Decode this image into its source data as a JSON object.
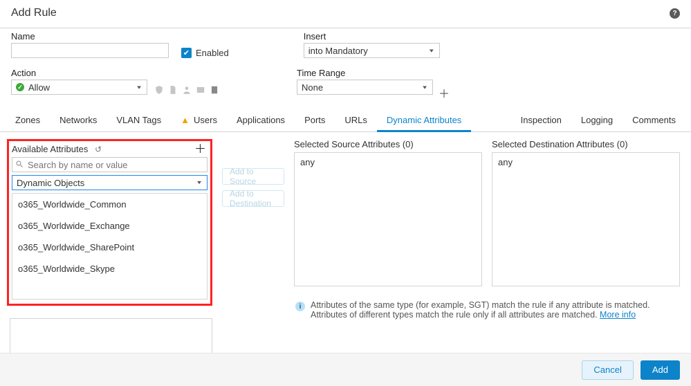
{
  "title": "Add Rule",
  "fields": {
    "name_label": "Name",
    "name_value": "",
    "enabled_label": "Enabled",
    "enabled_checked": true,
    "action_label": "Action",
    "action_value": "Allow",
    "insert_label": "Insert",
    "insert_value": "into Mandatory",
    "timerange_label": "Time Range",
    "timerange_value": "None"
  },
  "tabs": {
    "left": [
      "Zones",
      "Networks",
      "VLAN Tags",
      "Users",
      "Applications",
      "Ports",
      "URLs",
      "Dynamic Attributes"
    ],
    "right": [
      "Inspection",
      "Logging",
      "Comments"
    ],
    "active": "Dynamic Attributes",
    "users_warning": true
  },
  "available": {
    "title": "Available Attributes",
    "search_placeholder": "Search by name or value",
    "dropdown_value": "Dynamic Objects",
    "items": [
      "o365_Worldwide_Common",
      "o365_Worldwide_Exchange",
      "o365_Worldwide_SharePoint",
      "o365_Worldwide_Skype"
    ]
  },
  "mid_buttons": {
    "add_source": "Add to Source",
    "add_dest": "Add to Destination"
  },
  "source": {
    "title": "Selected Source Attributes (0)",
    "value": "any"
  },
  "dest": {
    "title": "Selected Destination Attributes (0)",
    "value": "any"
  },
  "hint": {
    "line1": "Attributes of the same type (for example, SGT) match the rule if any attribute is matched.",
    "line2a": "Attributes of different types match the rule only if all attributes are matched. ",
    "more": "More info"
  },
  "footer": {
    "cancel": "Cancel",
    "add": "Add"
  }
}
